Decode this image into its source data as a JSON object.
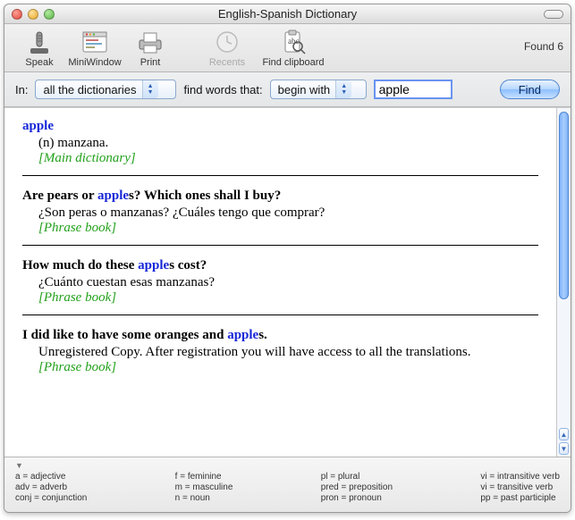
{
  "window": {
    "title": "English-Spanish Dictionary"
  },
  "toolbar": {
    "speak": "Speak",
    "miniwindow": "MiniWindow",
    "print": "Print",
    "recents": "Recents",
    "findclip": "Find clipboard",
    "found": "Found 6"
  },
  "search": {
    "in_label": "In:",
    "scope": "all the dictionaries",
    "match_label": "find words that:",
    "match_mode": "begin with",
    "query": "apple",
    "find_label": "Find"
  },
  "entries": [
    {
      "head_pre": "",
      "head_hl": "apple",
      "head_post": "",
      "def": "(n) manzana.",
      "source": "[Main dictionary]"
    },
    {
      "head_pre": "Are pears or ",
      "head_hl": "apple",
      "head_post": "s? Which ones shall I buy?",
      "def": "¿Son peras o manzanas? ¿Cuáles tengo que comprar?",
      "source": "[Phrase book]"
    },
    {
      "head_pre": "How much do these ",
      "head_hl": "apple",
      "head_post": "s cost?",
      "def": "¿Cuánto cuestan esas manzanas?",
      "source": "[Phrase book]"
    },
    {
      "head_pre": "I did like to have some oranges and ",
      "head_hl": "apple",
      "head_post": "s.",
      "def": "Unregistered Copy. After registration you will have access to all the translations.",
      "source": "[Phrase book]"
    }
  ],
  "legend": {
    "cols": [
      [
        "a = adjective",
        "adv = adverb",
        "conj = conjunction"
      ],
      [
        "f = feminine",
        "m = masculine",
        "n = noun"
      ],
      [
        "pl = plural",
        "pred = preposition",
        "pron = pronoun"
      ],
      [
        "vi = intransitive verb",
        "vi = transitive verb",
        "pp = past participle"
      ]
    ]
  }
}
